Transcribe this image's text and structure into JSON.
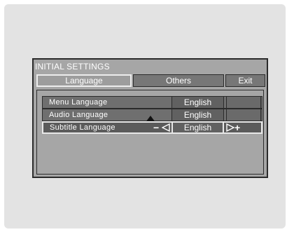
{
  "window": {
    "title": "INITIAL SETTINGS"
  },
  "tabs": [
    {
      "label": "Language",
      "selected": true
    },
    {
      "label": "Others",
      "selected": false
    },
    {
      "label": "Exit",
      "selected": false
    }
  ],
  "rows": [
    {
      "label": "Menu Language",
      "value": "English",
      "selected": false
    },
    {
      "label": "Audio Language",
      "value": "English",
      "selected": false
    },
    {
      "label": "Subtitle Language",
      "value": "English",
      "selected": true
    }
  ],
  "controls": {
    "decrease_symbol": "−",
    "increase_symbol": "+",
    "icons": [
      "scroll-up-icon",
      "arrow-left-icon",
      "arrow-right-icon"
    ]
  },
  "colors": {
    "osd_background": "#a6a6a6",
    "selection_outline": "#e8e8e8",
    "text": "#ffffff"
  }
}
